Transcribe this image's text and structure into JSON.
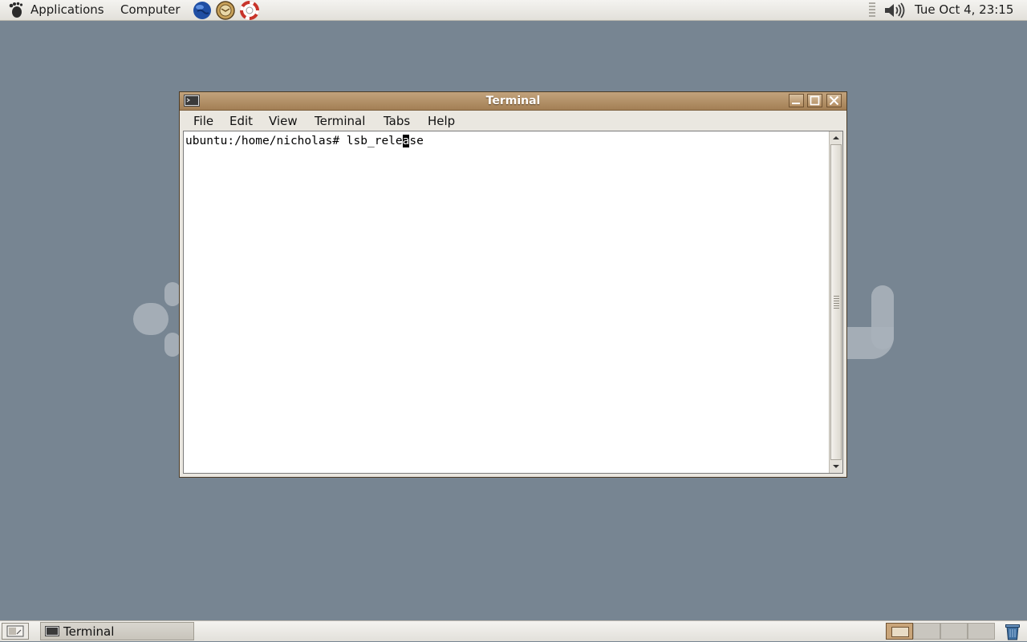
{
  "top_panel": {
    "menus": [
      {
        "label": "Applications",
        "icon": "gnome-foot-icon"
      },
      {
        "label": "Computer"
      }
    ],
    "launchers": [
      "web-browser-globe-icon",
      "email-client-icon",
      "help-lifebuoy-icon"
    ],
    "tray": {
      "icon": "volume-icon"
    },
    "clock": "Tue Oct  4, 23:15"
  },
  "window": {
    "title": "Terminal",
    "icon": "terminal-icon",
    "controls": [
      "minimize-icon",
      "maximize-icon",
      "close-icon"
    ],
    "menu": [
      "File",
      "Edit",
      "View",
      "Terminal",
      "Tabs",
      "Help"
    ],
    "terminal": {
      "prompt": "ubuntu:/home/nicholas# ",
      "command_before_cursor": "lsb_rele",
      "cursor_char": "a",
      "command_after_cursor": "se"
    }
  },
  "bottom_panel": {
    "show_desktop_icon": "show-desktop-icon",
    "task": {
      "label": "Terminal",
      "icon": "terminal-icon"
    },
    "workspaces": 4,
    "active_workspace": 1,
    "trash_icon": "trash-icon"
  },
  "colors": {
    "desktop": "#778592",
    "titlebar": "#b08a5e",
    "panel": "#eceae5"
  }
}
